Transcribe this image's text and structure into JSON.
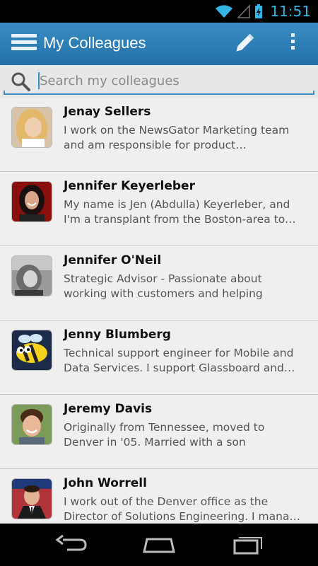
{
  "status_bar": {
    "time": "11:51"
  },
  "action_bar": {
    "title": "My Colleagues",
    "icons": {
      "menu": "menu-icon",
      "edit": "pencil-icon",
      "overflow": "overflow-menu-icon"
    }
  },
  "search": {
    "placeholder": "Search my colleagues",
    "value": ""
  },
  "colleagues": [
    {
      "name": "Jenay Sellers",
      "bio": "I work on the NewsGator Marketing team and am responsible for product…"
    },
    {
      "name": "Jennifer Keyerleber",
      "bio": "My name is Jen (Abdulla) Keyerleber, and I'm a transplant from the Boston-area to…"
    },
    {
      "name": "Jennifer O'Neil",
      "bio": "Strategic Advisor - Passionate about working with customers and helping them…"
    },
    {
      "name": "Jenny Blumberg",
      "bio": "Technical support engineer for Mobile and Data Services. I support Glassboard and…"
    },
    {
      "name": "Jeremy Davis",
      "bio": "Originally from Tennessee, moved to Denver in '05. Married with a son (Sammy…"
    },
    {
      "name": "John Worrell",
      "bio": "I work out of the Denver office as the Director of Solutions Engineering. I mana…"
    }
  ],
  "colors": {
    "action_bar": "#2a7bb5",
    "accent": "#33b5e5",
    "list_bg": "#efefef"
  }
}
